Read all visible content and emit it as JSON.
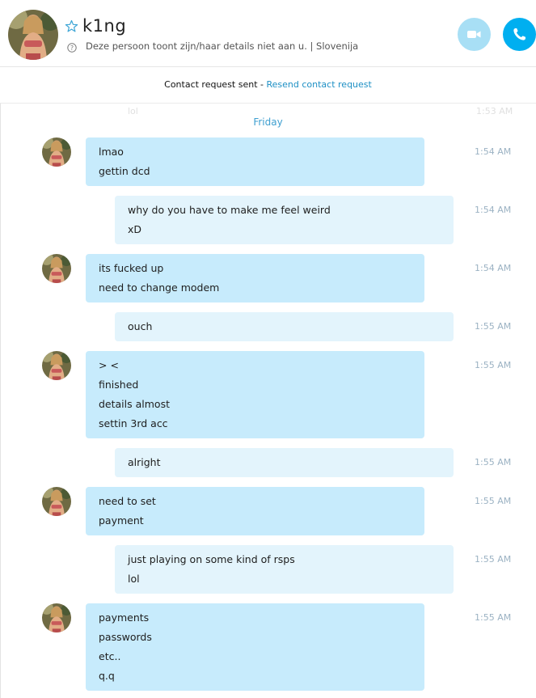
{
  "header": {
    "contact_name": "k1ng",
    "status_text": "Deze persoon toont zijn/haar details niet aan u.  |  Slovenija",
    "icons": {
      "favorite": "star-outline-icon",
      "info": "question-circle-icon",
      "video_call": "video-camera-icon",
      "audio_call": "phone-icon"
    },
    "colors": {
      "video_call_bg": "#a8dff5",
      "audio_call_bg": "#00aff0"
    }
  },
  "banner": {
    "text": "Contact request sent",
    "separator": " - ",
    "link": "Resend contact request"
  },
  "ghost": {
    "message": "lol",
    "time": "1:53 AM"
  },
  "day_divider": "Friday",
  "colors": {
    "incoming_bubble": "#c7ebfc",
    "outgoing_bubble": "#e3f4fc",
    "accent": "#1d8fc4",
    "timestamp": "#9bb2c3"
  },
  "messages": [
    {
      "direction": "incoming",
      "lines": [
        "lmao",
        "gettin dcd"
      ],
      "time": "1:54 AM"
    },
    {
      "direction": "outgoing",
      "lines": [
        "why do you have to make me feel weird",
        "xD"
      ],
      "time": "1:54 AM"
    },
    {
      "direction": "incoming",
      "lines": [
        "its fucked up",
        "need to change modem"
      ],
      "time": "1:54 AM"
    },
    {
      "direction": "outgoing",
      "lines": [
        "ouch"
      ],
      "time": "1:55 AM"
    },
    {
      "direction": "incoming",
      "lines": [
        "> <",
        "finished",
        "details almost",
        "settin 3rd acc"
      ],
      "time": "1:55 AM"
    },
    {
      "direction": "outgoing",
      "lines": [
        "alright"
      ],
      "time": "1:55 AM"
    },
    {
      "direction": "incoming",
      "lines": [
        "need to set",
        "payment"
      ],
      "time": "1:55 AM"
    },
    {
      "direction": "outgoing",
      "lines": [
        "just playing on some kind of rsps",
        "lol"
      ],
      "time": "1:55 AM"
    },
    {
      "direction": "incoming",
      "lines": [
        "payments",
        "passwords",
        "etc..",
        "q.q"
      ],
      "time": "1:55 AM"
    }
  ]
}
